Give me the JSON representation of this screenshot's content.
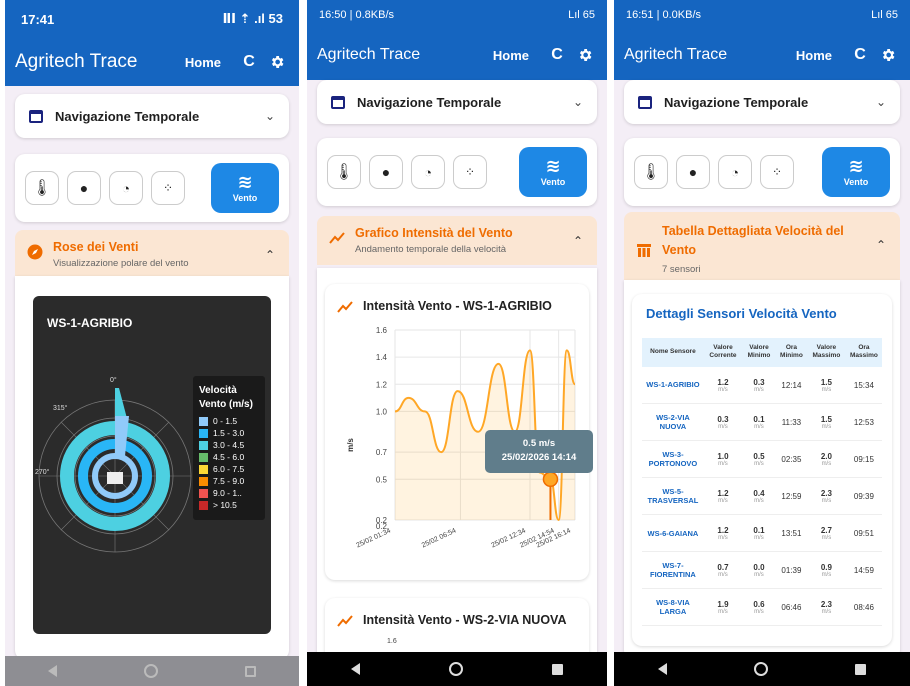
{
  "app": {
    "title": "Agritech Trace",
    "home_label": "Home",
    "refresh_glyph": "C",
    "nav_title": "Navigazione Temporale",
    "wind_label": "Vento"
  },
  "icons": [
    "thermometer-icon",
    "water-drop-icon",
    "gauge-icon",
    "dots-icon",
    "wind-icon",
    "calendar-icon",
    "compass-icon",
    "trend-icon",
    "table-icon",
    "gear-icon",
    "refresh-icon"
  ],
  "colors": {
    "primary": "#1565c0",
    "accent_orange": "#ef6c00",
    "section_bg": "#fbe6d3",
    "active_tool": "#1e88e5"
  },
  "screen1": {
    "status": {
      "time": "17:41",
      "icons": "ⅡⅠ ⇡ .ıl 53"
    },
    "section": {
      "title": "Rose dei Venti",
      "subtitle": "Visualizzazione polare del vento"
    },
    "rose": {
      "title": "WS-1-AGRIBIO",
      "angle_labels": [
        "0°",
        "270°",
        "315°"
      ],
      "legend_title": "Velocità Vento (m/s)",
      "legend": [
        {
          "label": "0 - 1.5",
          "color": "#90caf9"
        },
        {
          "label": "1.5 - 3.0",
          "color": "#29b6f6"
        },
        {
          "label": "3.0 - 4.5",
          "color": "#4dd0e1"
        },
        {
          "label": "4.5 - 6.0",
          "color": "#66bb6a"
        },
        {
          "label": "6.0 - 7.5",
          "color": "#fdd835"
        },
        {
          "label": "7.5 - 9.0",
          "color": "#fb8c00"
        },
        {
          "label": "9.0 - 1..",
          "color": "#ef5350"
        },
        {
          "label": "> 10.5",
          "color": "#c62828"
        }
      ]
    }
  },
  "screen2": {
    "status": {
      "time": "16:50 | 0.8KB/s",
      "icons": "Lıl 65"
    },
    "section": {
      "title": "Grafico Intensità del Vento",
      "subtitle": "Andamento temporale della velocità"
    },
    "chart_title": "Intensità Vento - WS-1-AGRIBIO",
    "chart2_title": "Intensità Vento - WS-2-VIA NUOVA",
    "chart2_first_tick": "1.6",
    "tooltip": {
      "value": "0.5 m/s",
      "time": "25/02/2026 14:14"
    }
  },
  "screen3": {
    "status": {
      "time": "16:51 | 0.0KB/s",
      "icons": "Lıl 65"
    },
    "section": {
      "title": "Tabella Dettagliata Velocità del Vento",
      "subtitle": "7 sensori"
    },
    "table": {
      "title": "Dettagli Sensori Velocità Vento",
      "headers": [
        "Nome Sensore",
        "Valore Corrente",
        "Valore Minimo",
        "Ora Minimo",
        "Valore Massimo",
        "Ora Massimo"
      ],
      "unit": "m/s",
      "rows": [
        {
          "name": "WS-1-AGRIBIO",
          "cur": "1.2",
          "min": "0.3",
          "tmin": "12:14",
          "max": "1.5",
          "tmax": "15:34"
        },
        {
          "name": "WS-2-VIA NUOVA",
          "cur": "0.3",
          "min": "0.1",
          "tmin": "11:33",
          "max": "1.5",
          "tmax": "12:53"
        },
        {
          "name": "WS-3-PORTONOVO",
          "cur": "1.0",
          "min": "0.5",
          "tmin": "02:35",
          "max": "2.0",
          "tmax": "09:15"
        },
        {
          "name": "WS-5-TRASVERSAL",
          "cur": "1.2",
          "min": "0.4",
          "tmin": "12:59",
          "max": "2.3",
          "tmax": "09:39"
        },
        {
          "name": "WS-6-GAIANA",
          "cur": "1.2",
          "min": "0.1",
          "tmin": "13:51",
          "max": "2.7",
          "tmax": "09:51"
        },
        {
          "name": "WS-7-FIORENTINA",
          "cur": "0.7",
          "min": "0.0",
          "tmin": "01:39",
          "max": "0.9",
          "tmax": "14:59"
        },
        {
          "name": "WS-8-VIA LARGA",
          "cur": "1.9",
          "min": "0.6",
          "tmin": "06:46",
          "max": "2.3",
          "tmax": "08:46"
        }
      ]
    }
  },
  "chart_data": {
    "type": "line",
    "title": "Intensità Vento - WS-1-AGRIBIO",
    "xlabel": "",
    "ylabel": "m/s",
    "y_tick_labels": [
      "0.2",
      "0.2",
      "0.5",
      "0.7",
      "1.0",
      "1.2",
      "1.4",
      "1.6"
    ],
    "ylim": [
      0.2,
      1.6
    ],
    "x_tick_labels": [
      "25/02 01:34",
      "25/02 06:54",
      "25/02 12:34",
      "25/02 14:54",
      "25/02 16:14"
    ],
    "grid": true,
    "series": [
      {
        "values": [
          {
            "x": "25/02 01:34",
            "y": 1.0
          },
          {
            "x": "25/02 02:40",
            "y": 1.1
          },
          {
            "x": "25/02 04:00",
            "y": 1.0
          },
          {
            "x": "25/02 05:20",
            "y": 0.7
          },
          {
            "x": "25/02 06:40",
            "y": 1.15
          },
          {
            "x": "25/02 08:20",
            "y": 0.85
          },
          {
            "x": "25/02 10:00",
            "y": 1.35
          },
          {
            "x": "25/02 11:20",
            "y": 0.85
          },
          {
            "x": "25/02 12:34",
            "y": 1.45
          },
          {
            "x": "25/02 13:20",
            "y": 0.55
          },
          {
            "x": "25/02 14:14",
            "y": 0.5
          },
          {
            "x": "25/02 14:54",
            "y": 0.2
          },
          {
            "x": "25/02 15:34",
            "y": 1.45
          },
          {
            "x": "25/02 16:14",
            "y": 1.2
          }
        ]
      }
    ],
    "highlight": {
      "x": "25/02 14:14",
      "y": 0.5
    }
  }
}
